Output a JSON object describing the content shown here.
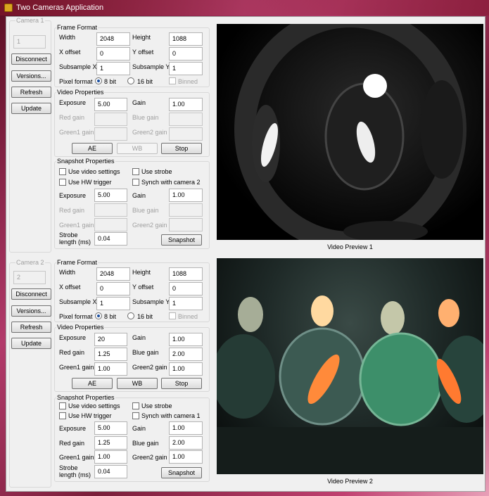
{
  "window": {
    "title": "Two Cameras Application"
  },
  "cameras": [
    {
      "label": "Camera 1",
      "id_value": "1",
      "buttons": {
        "disconnect": "Disconnect",
        "versions": "Versions...",
        "refresh": "Refresh",
        "update": "Update"
      },
      "frame_format": {
        "title": "Frame Format",
        "width_label": "Width",
        "width": "2048",
        "height_label": "Height",
        "height": "1088",
        "xoffset_label": "X offset",
        "xoffset": "0",
        "yoffset_label": "Y offset",
        "yoffset": "0",
        "subx_label": "Subsample X",
        "subx": "1",
        "suby_label": "Subsample Y",
        "suby": "1",
        "pixel_label": "Pixel format",
        "opt8": "8 bit",
        "opt16": "16 bit",
        "binned": "Binned"
      },
      "video": {
        "title": "Video Properties",
        "exposure_label": "Exposure",
        "exposure": "5.00",
        "gain_label": "Gain",
        "gain": "1.00",
        "red_label": "Red gain",
        "red": "",
        "blue_label": "Blue gain",
        "blue": "",
        "green1_label": "Green1  gain",
        "green1": "",
        "green2_label": "Green2  gain",
        "green2": "",
        "ae": "AE",
        "wb": "WB",
        "stop": "Stop"
      },
      "snapshot": {
        "title": "Snapshot Properties",
        "use_video": "Use video settings",
        "use_strobe": "Use strobe",
        "use_hw": "Use HW trigger",
        "synch": "Synch with camera 2",
        "exposure_label": "Exposure",
        "exposure": "5.00",
        "gain_label": "Gain",
        "gain": "1.00",
        "red_label": "Red  gain",
        "red": "",
        "blue_label": "Blue gain",
        "blue": "",
        "green1_label": "Green1 gain",
        "green1": "",
        "green2_label": "Green2 gain",
        "green2": "",
        "strobe_label1": "Strobe",
        "strobe_label2": "length (ms)",
        "strobe": "0.04",
        "snapshot_btn": "Snapshot"
      },
      "preview_caption": "Video Preview 1"
    },
    {
      "label": "Camera 2",
      "id_value": "2",
      "buttons": {
        "disconnect": "Disconnect",
        "versions": "Versions...",
        "refresh": "Refresh",
        "update": "Update"
      },
      "frame_format": {
        "title": "Frame Format",
        "width_label": "Width",
        "width": "2048",
        "height_label": "Height",
        "height": "1088",
        "xoffset_label": "X offset",
        "xoffset": "0",
        "yoffset_label": "Y offset",
        "yoffset": "0",
        "subx_label": "Subsample X",
        "subx": "1",
        "suby_label": "Subsample Y",
        "suby": "1",
        "pixel_label": "Pixel format",
        "opt8": "8 bit",
        "opt16": "16 bit",
        "binned": "Binned"
      },
      "video": {
        "title": "Video Properties",
        "exposure_label": "Exposure",
        "exposure": "20",
        "gain_label": "Gain",
        "gain": "1.00",
        "red_label": "Red gain",
        "red": "1.25",
        "blue_label": "Blue gain",
        "blue": "2.00",
        "green1_label": "Green1  gain",
        "green1": "1.00",
        "green2_label": "Green2  gain",
        "green2": "1.00",
        "ae": "AE",
        "wb": "WB",
        "stop": "Stop"
      },
      "snapshot": {
        "title": "Snapshot Properties",
        "use_video": "Use video settings",
        "use_strobe": "Use strobe",
        "use_hw": "Use HW trigger",
        "synch": "Synch with camera 1",
        "exposure_label": "Exposure",
        "exposure": "5.00",
        "gain_label": "Gain",
        "gain": "1.00",
        "red_label": "Red  gain",
        "red": "1.25",
        "blue_label": "Blue gain",
        "blue": "2.00",
        "green1_label": "Green1 gain",
        "green1": "1.00",
        "green2_label": "Green2 gain",
        "green2": "1.00",
        "strobe_label1": "Strobe",
        "strobe_label2": "length (ms)",
        "strobe": "0.04",
        "snapshot_btn": "Snapshot"
      },
      "preview_caption": "Video Preview 2"
    }
  ]
}
